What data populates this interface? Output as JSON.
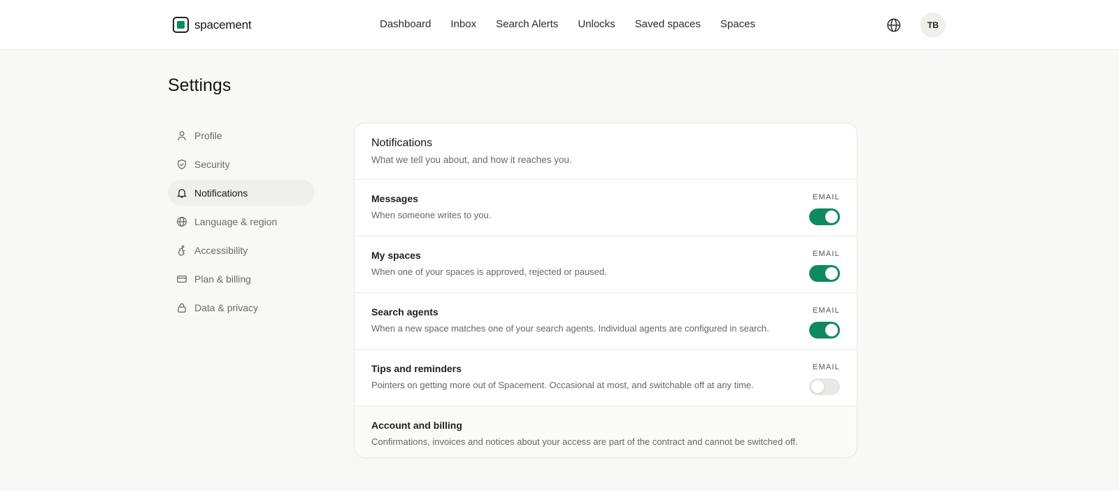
{
  "header": {
    "brand_name": "spacement",
    "nav": [
      "Dashboard",
      "Inbox",
      "Search Alerts",
      "Unlocks",
      "Saved spaces",
      "Spaces"
    ],
    "avatar_initials": "TB"
  },
  "page": {
    "title": "Settings"
  },
  "sidebar": {
    "items": [
      {
        "label": "Profile",
        "icon": "user-icon",
        "active": false
      },
      {
        "label": "Security",
        "icon": "shield-icon",
        "active": false
      },
      {
        "label": "Notifications",
        "icon": "bell-icon",
        "active": true
      },
      {
        "label": "Language & region",
        "icon": "globe-icon",
        "active": false
      },
      {
        "label": "Accessibility",
        "icon": "accessibility-icon",
        "active": false
      },
      {
        "label": "Plan & billing",
        "icon": "credit-card-icon",
        "active": false
      },
      {
        "label": "Data & privacy",
        "icon": "lock-icon",
        "active": false
      }
    ]
  },
  "notifications": {
    "title": "Notifications",
    "subtitle": "What we tell you about, and how it reaches you.",
    "rows": [
      {
        "title": "Messages",
        "description": "When someone writes to you.",
        "channel": "EMAIL",
        "enabled": true
      },
      {
        "title": "My spaces",
        "description": "When one of your spaces is approved, rejected or paused.",
        "channel": "EMAIL",
        "enabled": true
      },
      {
        "title": "Search agents",
        "description": "When a new space matches one of your search agents. Individual agents are configured in search.",
        "channel": "EMAIL",
        "enabled": true
      },
      {
        "title": "Tips and reminders",
        "description": "Pointers on getting more out of Spacement. Occasional at most, and switchable off at any time.",
        "channel": "EMAIL",
        "enabled": false
      }
    ],
    "account": {
      "title": "Account and billing",
      "description": "Confirmations, invoices and notices about your access are part of the contract and cannot be switched off."
    }
  },
  "colors": {
    "accent": "#0f8a5f",
    "background": "#f8f8f6",
    "toggle_off": "#e8e8e5"
  }
}
